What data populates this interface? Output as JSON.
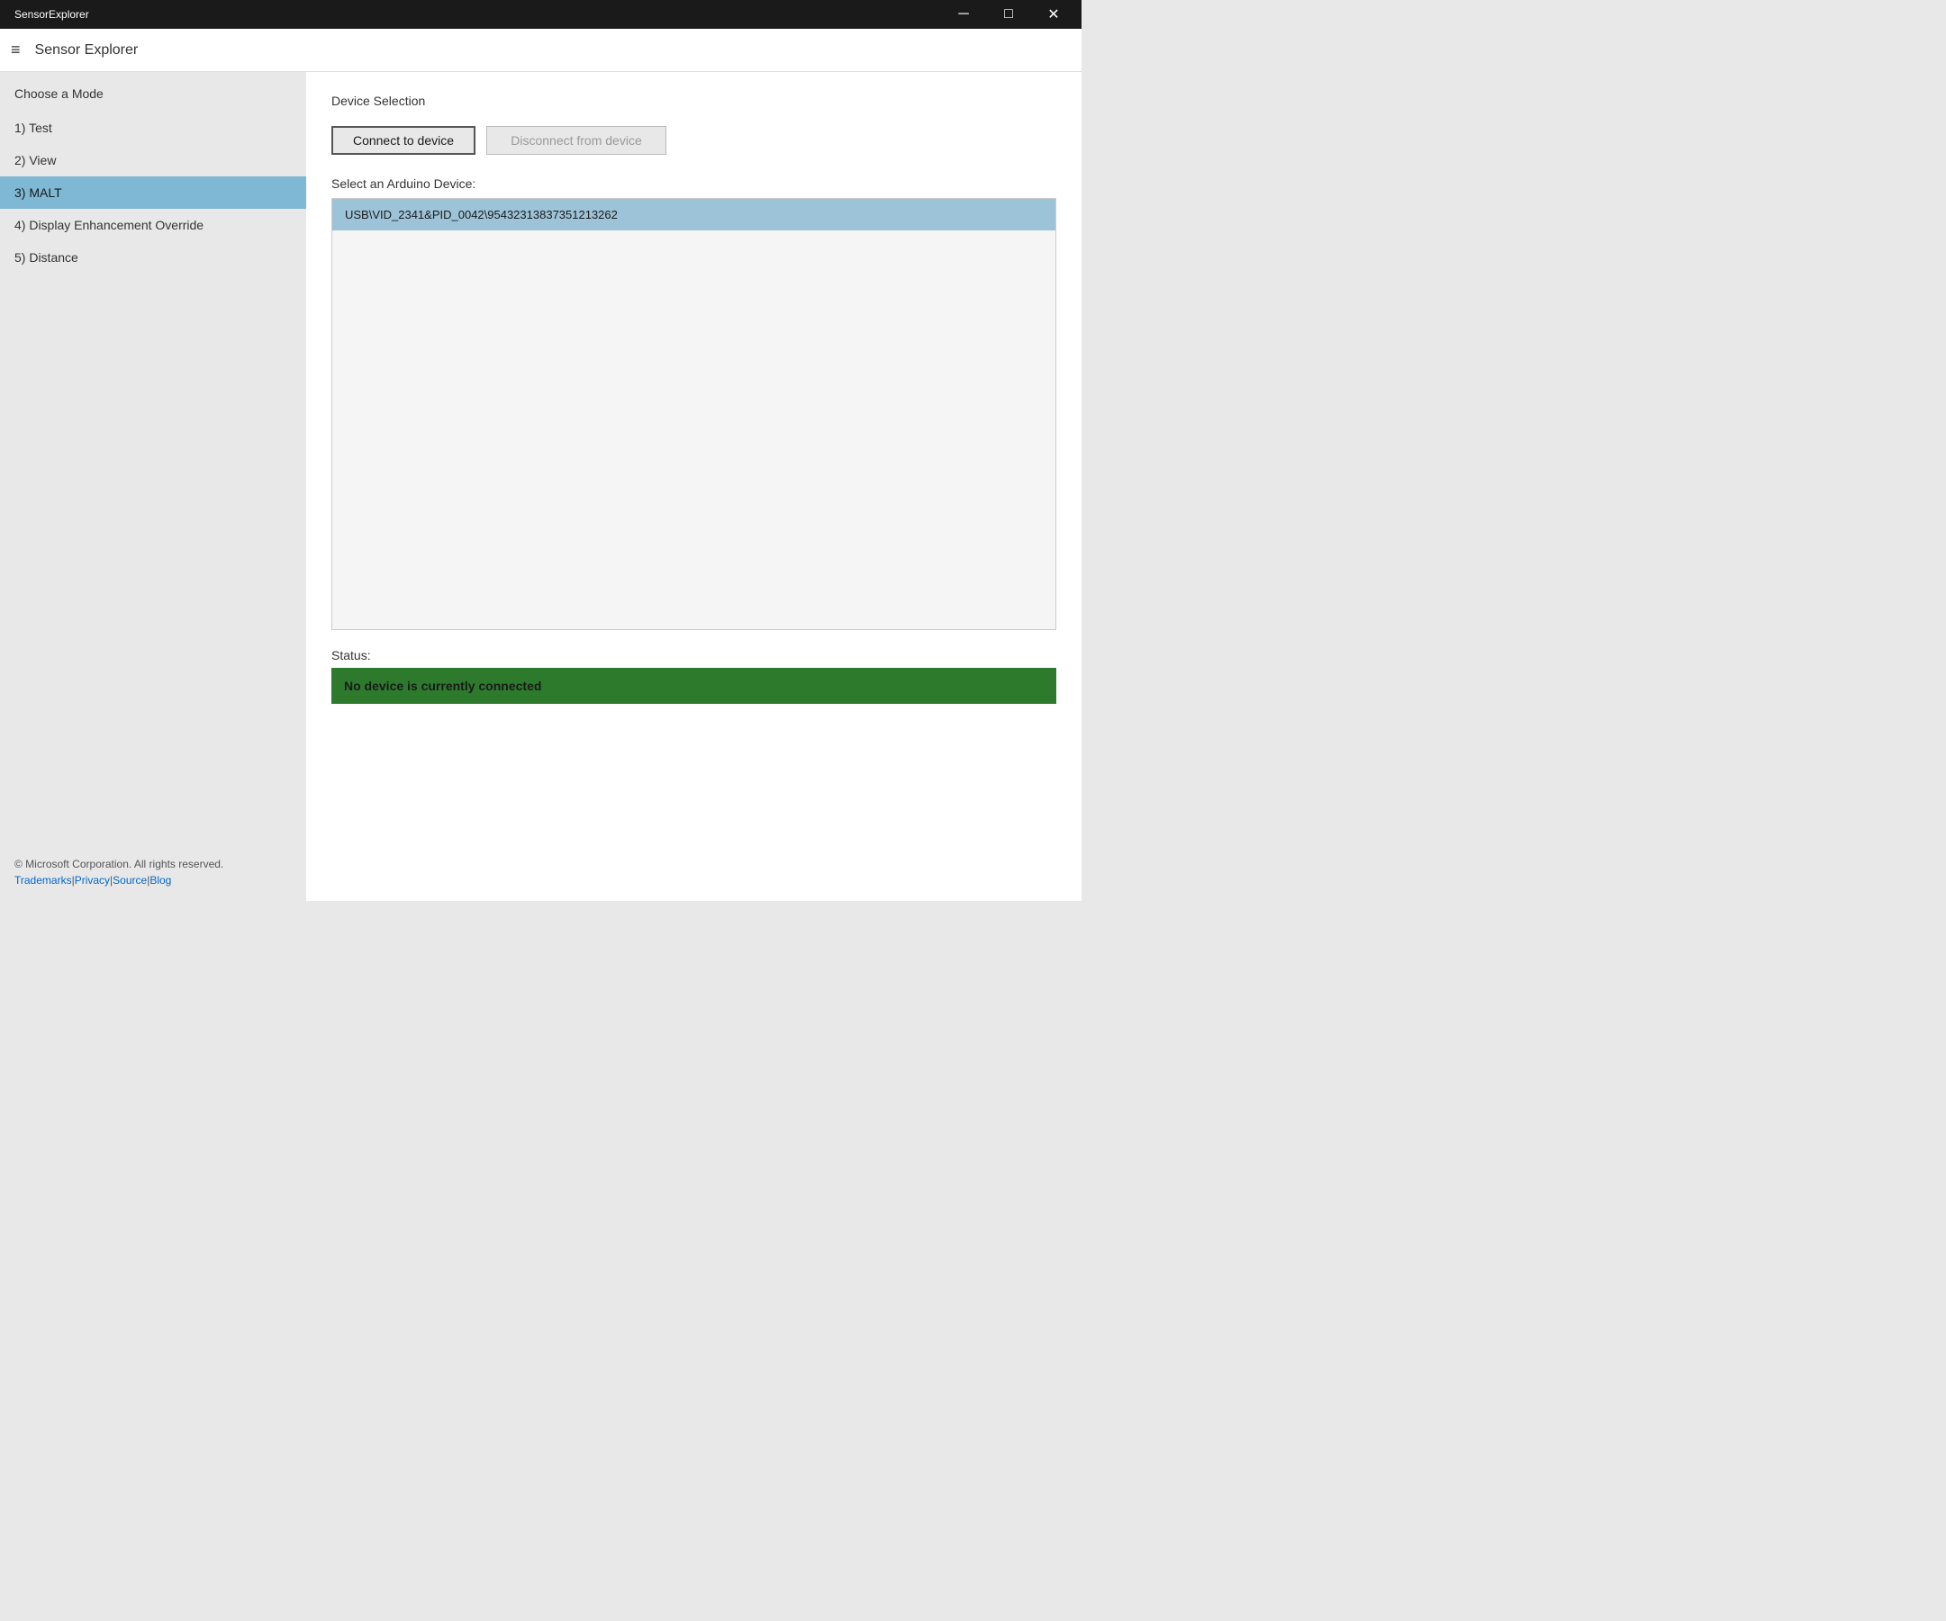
{
  "window": {
    "title": "SensorExplorer",
    "minimize_label": "─",
    "maximize_label": "□",
    "close_label": "✕"
  },
  "header": {
    "hamburger": "≡",
    "app_title": "Sensor Explorer"
  },
  "sidebar": {
    "heading": "Choose a Mode",
    "items": [
      {
        "id": "test",
        "label": "1) Test",
        "active": false
      },
      {
        "id": "view",
        "label": "2) View",
        "active": false
      },
      {
        "id": "malt",
        "label": "3) MALT",
        "active": true
      },
      {
        "id": "display",
        "label": "4) Display Enhancement Override",
        "active": false
      },
      {
        "id": "distance",
        "label": "5) Distance",
        "active": false
      }
    ],
    "footer_copyright": "© Microsoft Corporation. All rights reserved.",
    "footer_links": [
      {
        "label": "Trademarks",
        "url": "#"
      },
      {
        "label": "Privacy",
        "url": "#"
      },
      {
        "label": "Source",
        "url": "#"
      },
      {
        "label": "Blog",
        "url": "#"
      }
    ]
  },
  "content": {
    "section_title": "Device Selection",
    "connect_button": "Connect to device",
    "disconnect_button": "Disconnect from device",
    "device_select_label": "Select an Arduino Device:",
    "devices": [
      {
        "id": "dev1",
        "label": "USB\\VID_2341&PID_0042\\95432313837351213262",
        "selected": true
      }
    ],
    "status_label": "Status:",
    "status_message": "No device is currently connected"
  }
}
